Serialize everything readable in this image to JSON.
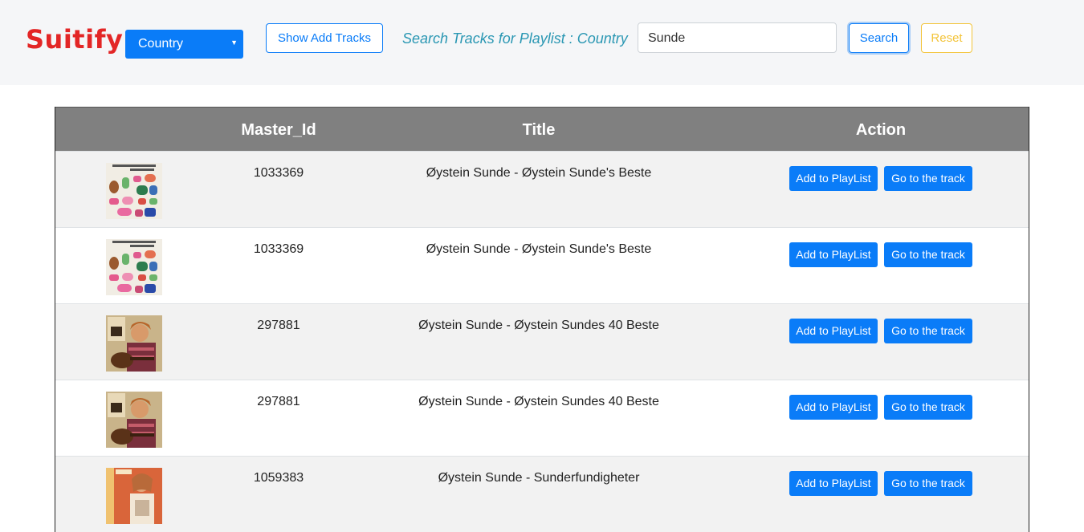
{
  "navbar": {
    "brand": "Suitify",
    "playlist_select": "Country",
    "show_add_tracks_label": "Show Add Tracks",
    "search_label": "Search Tracks for Playlist : Country",
    "search_value": "Sunde",
    "search_button": "Search",
    "reset_button": "Reset"
  },
  "table": {
    "headers": [
      "",
      "Master_Id",
      "Title",
      "Action"
    ],
    "rows": [
      {
        "master_id": "1033369",
        "title": "Øystein Sunde - Øystein Sunde's Beste",
        "add_label": "Add to PlayList",
        "go_label": "Go to the track",
        "cover": "beste"
      },
      {
        "master_id": "1033369",
        "title": "Øystein Sunde - Øystein Sunde's Beste",
        "add_label": "Add to PlayList",
        "go_label": "Go to the track",
        "cover": "beste"
      },
      {
        "master_id": "297881",
        "title": "Øystein Sunde - Øystein Sundes 40 Beste",
        "add_label": "Add to PlayList",
        "go_label": "Go to the track",
        "cover": "forty"
      },
      {
        "master_id": "297881",
        "title": "Øystein Sunde - Øystein Sundes 40 Beste",
        "add_label": "Add to PlayList",
        "go_label": "Go to the track",
        "cover": "forty"
      },
      {
        "master_id": "1059383",
        "title": "Øystein Sunde - Sunderfundigheter",
        "add_label": "Add to PlayList",
        "go_label": "Go to the track",
        "cover": "sunder"
      }
    ]
  },
  "colors": {
    "brand": "#e32626",
    "primary": "#0a7cf8",
    "warning": "#f3c43a",
    "header_bg": "#808080"
  }
}
